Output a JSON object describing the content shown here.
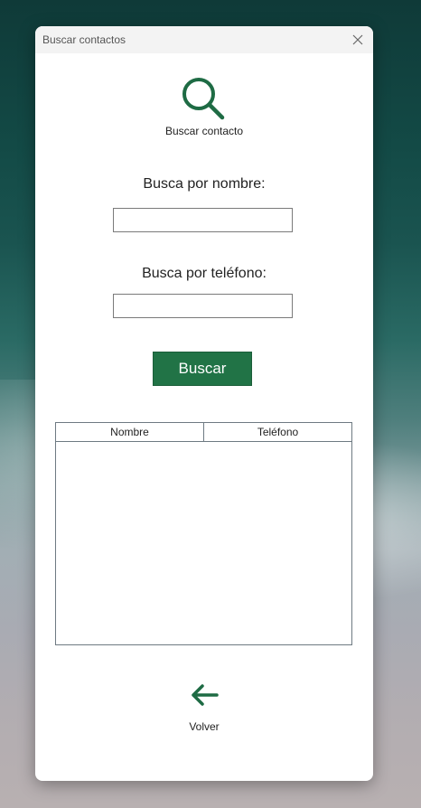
{
  "window": {
    "title": "Buscar contactos"
  },
  "hero": {
    "icon": "search-icon",
    "label": "Buscar contacto"
  },
  "form": {
    "name_label": "Busca por nombre:",
    "name_value": "",
    "phone_label": "Busca por teléfono:",
    "phone_value": "",
    "search_button": "Buscar"
  },
  "table": {
    "columns": [
      "Nombre",
      "Teléfono"
    ],
    "rows": []
  },
  "footer": {
    "back_icon": "arrow-left-icon",
    "back_label": "Volver"
  },
  "colors": {
    "accent": "#217346",
    "icon": "#1e6b44"
  }
}
